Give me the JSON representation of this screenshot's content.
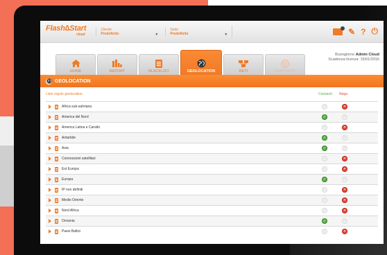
{
  "header": {
    "logo_text": "Flash∆Start",
    "logo_sub": "cloud",
    "client_label": "Cliente",
    "client_value": "Predefinito",
    "site_label": "Sede",
    "site_value": "Predefinito"
  },
  "tabs": [
    {
      "label": "HOME",
      "icon": "home-icon"
    },
    {
      "label": "REPORT",
      "icon": "bar-chart-icon"
    },
    {
      "label": "BLACKLIST",
      "icon": "document-icon"
    },
    {
      "label": "GEOLOCATION",
      "icon": "globe-icon"
    },
    {
      "label": "RETI",
      "icon": "network-icon"
    },
    {
      "label": "SUPPORTO",
      "icon": "support-icon"
    }
  ],
  "greeting": {
    "line1_prefix": "Buongiorno",
    "user": "Admin Cloud",
    "line2": "Scadenza licenza: 15/01/2016"
  },
  "section": {
    "title": "GEOLOCATION"
  },
  "list": {
    "title": "Liste regole geolocation",
    "col_allow": "Consenti",
    "col_deny": "Nega",
    "rows": [
      {
        "name": "Africa sub-sahriana",
        "allow": false,
        "deny": true
      },
      {
        "name": "America del Nord",
        "allow": true,
        "deny": false
      },
      {
        "name": "America Latina e Caraibi",
        "allow": false,
        "deny": true
      },
      {
        "name": "Antartide",
        "allow": true,
        "deny": false
      },
      {
        "name": "Asia",
        "allow": true,
        "deny": false
      },
      {
        "name": "Connessioni satellitari",
        "allow": false,
        "deny": true
      },
      {
        "name": "Est Europa",
        "allow": false,
        "deny": true
      },
      {
        "name": "Europa",
        "allow": true,
        "deny": false
      },
      {
        "name": "IP non definiti",
        "allow": false,
        "deny": true
      },
      {
        "name": "Medio Oriente",
        "allow": false,
        "deny": true
      },
      {
        "name": "Nord Africa",
        "allow": false,
        "deny": true
      },
      {
        "name": "Oceania",
        "allow": true,
        "deny": false
      },
      {
        "name": "Paesi Baltici",
        "allow": false,
        "deny": true
      }
    ]
  },
  "colors": {
    "accent": "#f07a27",
    "backdrop": "#f36f55",
    "allow": "#5db04a",
    "deny": "#e5483a"
  }
}
